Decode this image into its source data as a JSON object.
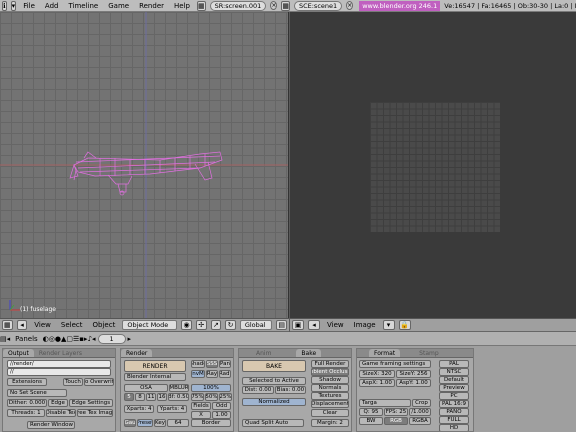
{
  "top_bar": {
    "menus": [
      "File",
      "Add",
      "Timeline",
      "Game",
      "Render",
      "Help"
    ],
    "screen_field": "SR:screen.001",
    "scene_field": "SCE:scene1",
    "url": "www.blender.org 246.1",
    "stats": "Ve:16547 | Fa:16465 | Ob:30-30 | La:0 | Mem:5.75M ("
  },
  "viewport_3d": {
    "object_label": "(1) fuselage",
    "model_color": "#e070e0",
    "bg_color": "#737373"
  },
  "viewport_header_3d": {
    "menus": [
      "View",
      "Select",
      "Object"
    ],
    "mode": "Object Mode",
    "orientation": "Global"
  },
  "viewport_header_img": {
    "menus": [
      "View",
      "Image"
    ]
  },
  "buttons_window": {
    "panels_label": "Panels",
    "frame": "1",
    "output": {
      "tabs": [
        "Output",
        "Render Layers"
      ],
      "path1": "//render/",
      "path2": "//",
      "extensions": "Extensions",
      "touch": "Touch",
      "no_overwrite": "No Overwrite",
      "no_set_scene": "No Set Scene",
      "dither": "Dither: 0.000",
      "edge": "Edge",
      "edge_settings": "Edge Settings",
      "threads": "Threads: 1",
      "disable_tex": "Disable Tex",
      "free_tex": "Free Tex Image",
      "render_window": "Render Window"
    },
    "render": {
      "tab": "Render",
      "render_btn": "RENDER",
      "engine": "Blender Internal",
      "shadow": "Shado",
      "sss": "SSS",
      "pano": "Pan",
      "envmap": "EnvMa",
      "ray": "Ray",
      "radio": "Radi",
      "osa": "OSA",
      "mblur": "MBLUR",
      "osa_levels": [
        "5",
        "8",
        "11",
        "16"
      ],
      "bf": "Bf: 0.50",
      "percent_100": "100%",
      "percents": [
        "75%",
        "50%",
        "25%"
      ],
      "xparts": "Xparts: 4",
      "yparts": "Yparts: 4",
      "fields": "Fields",
      "odd": "Odd",
      "x": "X",
      "gauss": "Gau",
      "filter": "Preset",
      "key": "Key",
      "sixtyfour": "64",
      "border": "Border",
      "bsc_val": "1.00"
    },
    "bake": {
      "tabs": [
        "Anim",
        "Bake"
      ],
      "bake_btn": "BAKE",
      "selected_to_active": "Selected to Active",
      "dist": "Dist: 0.00",
      "bias": "Bias: 0.00",
      "normalized": "Normalized",
      "quad_split": "Quad Split Auto",
      "margin": "Margin: 2",
      "options": [
        "Full Render",
        "Ambient Occlusion",
        "Shadow",
        "Normals",
        "Textures",
        "Displacement"
      ],
      "clear": "Clear"
    },
    "format": {
      "tabs": [
        "Format",
        "Stamp"
      ],
      "preset": "Game framing settings",
      "sizex": "SizeX: 320",
      "sizey": "SizeY: 256",
      "aspx": "AspX: 1.00",
      "aspy": "AspY: 1.00",
      "targa": "Targa",
      "crop": "Crop",
      "quality": "Q: 95",
      "fps": "FPS: 25",
      "fps_div": "/1.000",
      "bw": "BW",
      "rgb": "RGB",
      "rgba": "RGBA",
      "presets": [
        "PAL",
        "NTSC",
        "Default",
        "Preview",
        "PC",
        "PAL 16:9",
        "PANO",
        "FULL",
        "HD"
      ]
    }
  }
}
